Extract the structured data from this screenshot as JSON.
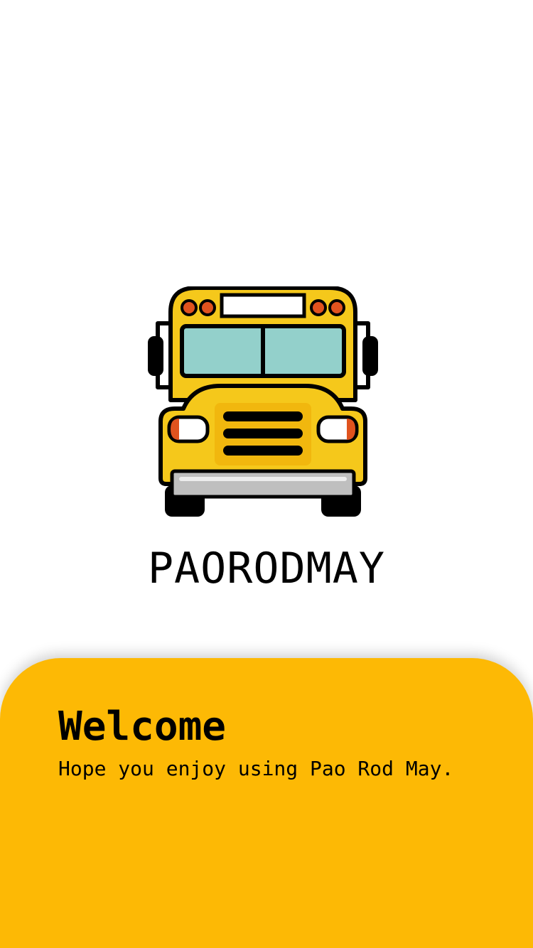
{
  "colors": {
    "accent": "#FDB905",
    "bus_body": "#F5C81B",
    "bus_window": "#93D0CB",
    "bus_light": "#E0531E",
    "text": "#000000"
  },
  "splash": {
    "logo_icon": "school-bus-icon",
    "brand_name": "PAORODMAY"
  },
  "welcome": {
    "title": "Welcome",
    "subtitle": "Hope you enjoy using Pao Rod May."
  }
}
